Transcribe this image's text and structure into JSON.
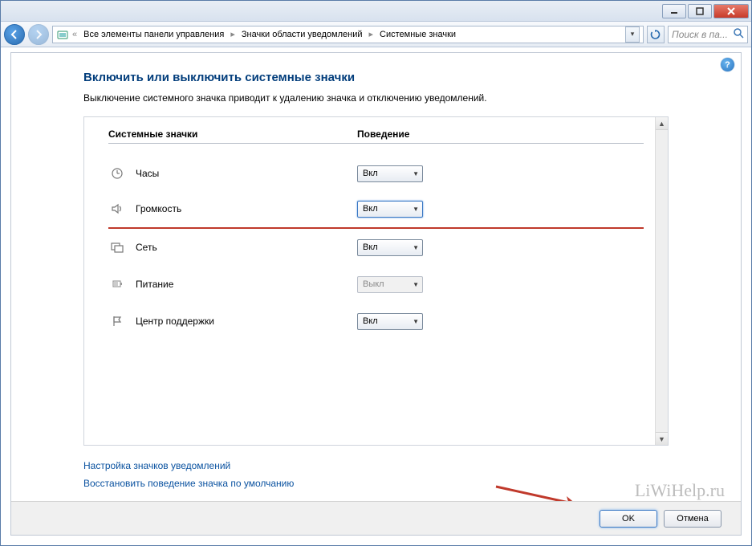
{
  "breadcrumb": {
    "items": [
      "Все элементы панели управления",
      "Значки области уведомлений",
      "Системные значки"
    ]
  },
  "search": {
    "placeholder": "Поиск в па..."
  },
  "page": {
    "title": "Включить или выключить системные значки",
    "desc": "Выключение системного значка приводит к удалению значка и отключению уведомлений."
  },
  "columns": {
    "left": "Системные значки",
    "right": "Поведение"
  },
  "options": {
    "on": "Вкл",
    "off": "Выкл"
  },
  "rows": [
    {
      "icon": "clock",
      "label": "Часы",
      "value": "Вкл",
      "disabled": false,
      "highlight": false
    },
    {
      "icon": "volume",
      "label": "Громкость",
      "value": "Вкл",
      "disabled": false,
      "highlight": true
    },
    {
      "icon": "network",
      "label": "Сеть",
      "value": "Вкл",
      "disabled": false,
      "highlight": false
    },
    {
      "icon": "power",
      "label": "Питание",
      "value": "Выкл",
      "disabled": true,
      "highlight": false
    },
    {
      "icon": "flag",
      "label": "Центр поддержки",
      "value": "Вкл",
      "disabled": false,
      "highlight": false
    }
  ],
  "links": {
    "configure": "Настройка значков уведомлений",
    "restore": "Восстановить поведение значка по умолчанию"
  },
  "buttons": {
    "ok": "OK",
    "cancel": "Отмена"
  },
  "watermark": "LiWiHelp.ru"
}
